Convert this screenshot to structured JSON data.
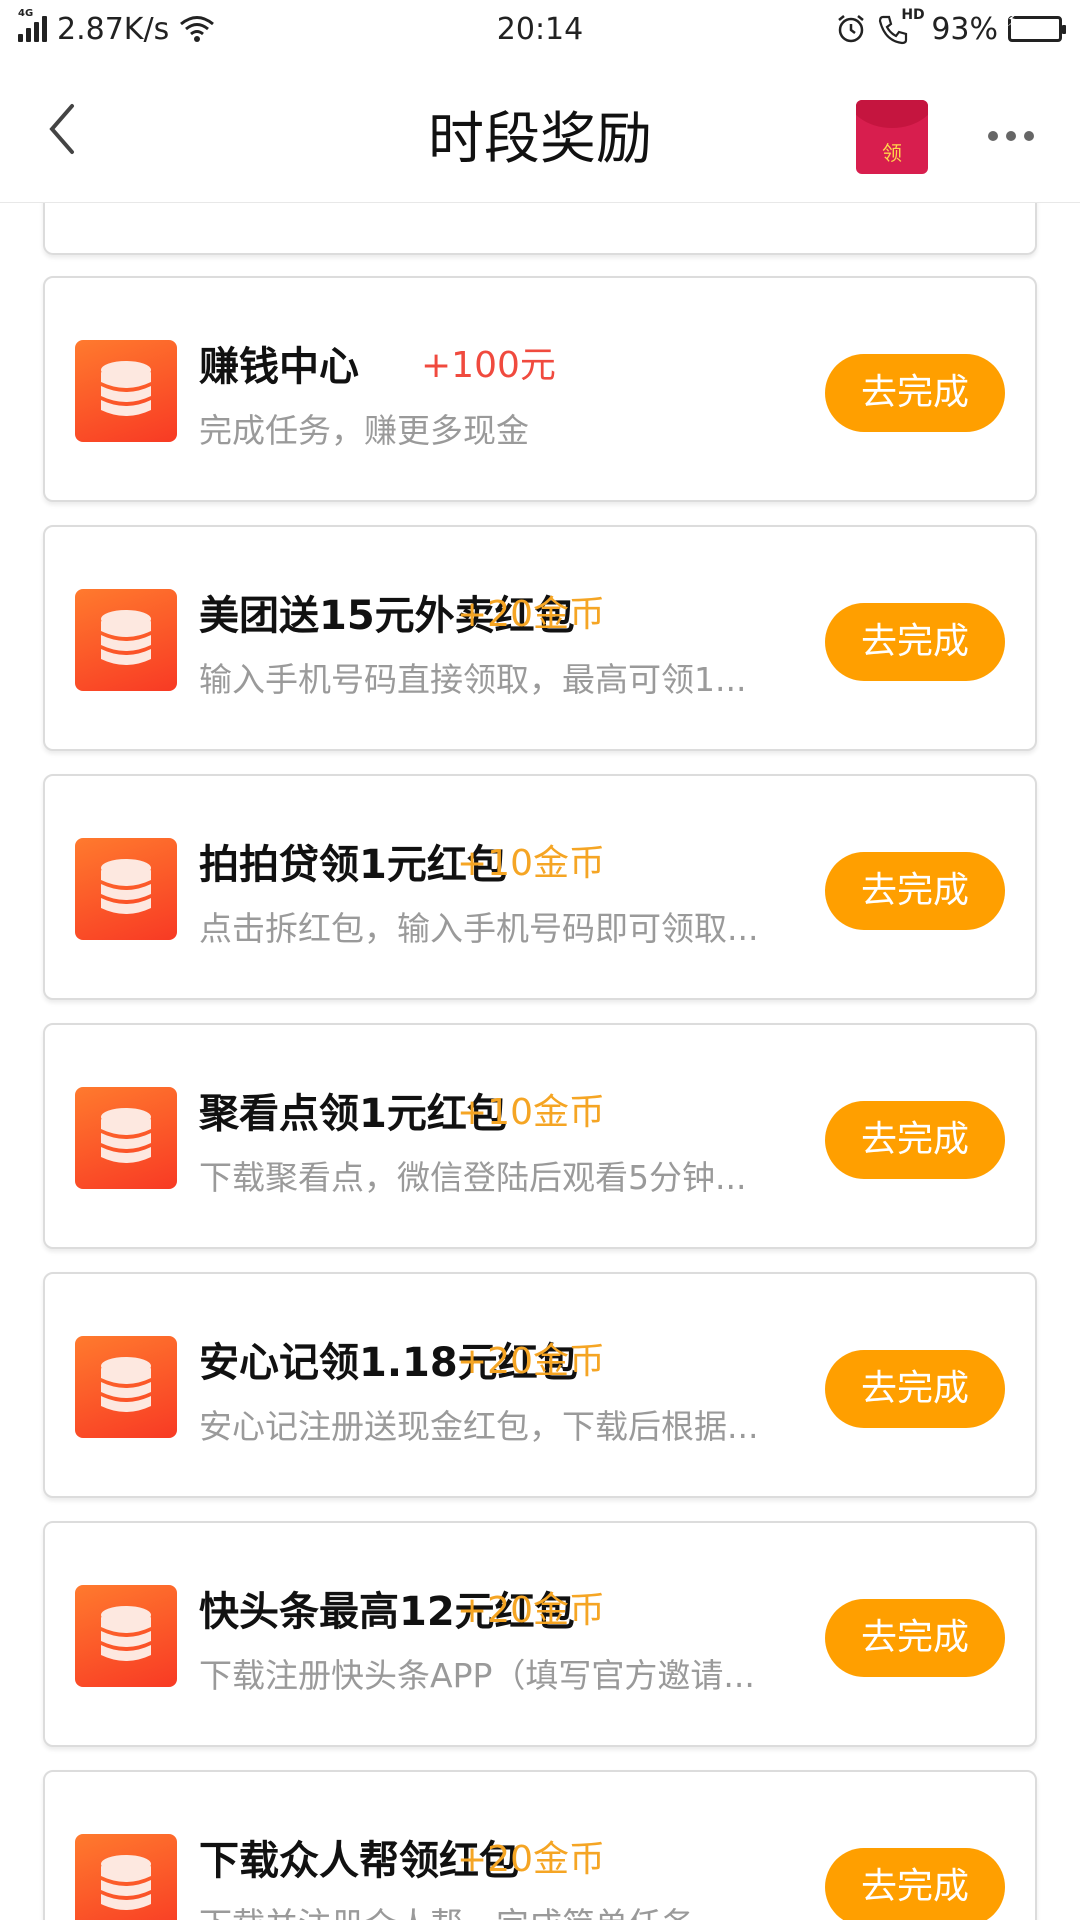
{
  "status_bar": {
    "network": "4G",
    "speed": "2.87K/s",
    "time": "20:14",
    "hd_label": "HD",
    "battery": "93%",
    "battery_level": 0.93
  },
  "header": {
    "title": "时段奖励",
    "red_packet_label": "领"
  },
  "colors": {
    "accent_button": "#ff9f00",
    "reward_red": "#f04a3e",
    "reward_orange": "#f5a524",
    "icon_gradient_start": "#ff7a2e",
    "icon_gradient_end": "#f83a24"
  },
  "tasks": [
    {
      "name": "赚钱中心",
      "reward": "+100元",
      "desc": "完成任务，赚更多现金",
      "button": "去完成"
    },
    {
      "name": "美团送15元外卖红包",
      "reward": "+20金币",
      "desc": "输入手机号码直接领取，最高可领1...",
      "button": "去完成"
    },
    {
      "name": "拍拍贷领1元红包",
      "reward": "+10金币",
      "desc": "点击拆红包，输入手机号码即可领取...",
      "button": "去完成"
    },
    {
      "name": "聚看点领1元红包",
      "reward": "+10金币",
      "desc": "下载聚看点，微信登陆后观看5分钟...",
      "button": "去完成"
    },
    {
      "name": "安心记领1.18元红包",
      "reward": "+20金币",
      "desc": "安心记注册送现金红包，下载后根据...",
      "button": "去完成"
    },
    {
      "name": "快头条最高12元红包",
      "reward": "+20金币",
      "desc": "下载注册快头条APP（填写官方邀请...",
      "button": "去完成"
    },
    {
      "name": "下载众人帮领红包",
      "reward": "+20金币",
      "desc": "下载并注册众人帮，完成简单任务...",
      "button": "去完成"
    }
  ]
}
